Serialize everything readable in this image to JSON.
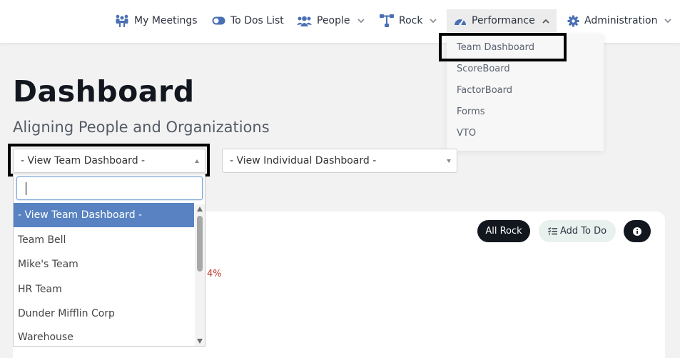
{
  "nav": {
    "my_meetings": "My Meetings",
    "to_dos_list": "To Dos List",
    "people": "People",
    "rock": "Rock",
    "performance": "Performance",
    "administration": "Administration"
  },
  "performance_menu": {
    "items": [
      "Team Dashboard",
      "ScoreBoard",
      "FactorBoard",
      "Forms",
      "VTO"
    ]
  },
  "page": {
    "title": "Dashboard",
    "subtitle": "Aligning People and Organizations"
  },
  "team_select": {
    "value": "- View Team Dashboard -",
    "options": [
      "- View Team Dashboard -",
      "Team Bell",
      "Mike's Team",
      "HR Team",
      "Dunder Mifflin Corp",
      "Warehouse"
    ]
  },
  "individual_select": {
    "value": "- View Individual Dashboard -"
  },
  "card": {
    "all_rock": "All Rock",
    "add_to_do": "Add To Do",
    "percent": "4%"
  },
  "colors": {
    "accent": "#5882c1",
    "dark": "#12161f",
    "warning": "#c0392b"
  }
}
